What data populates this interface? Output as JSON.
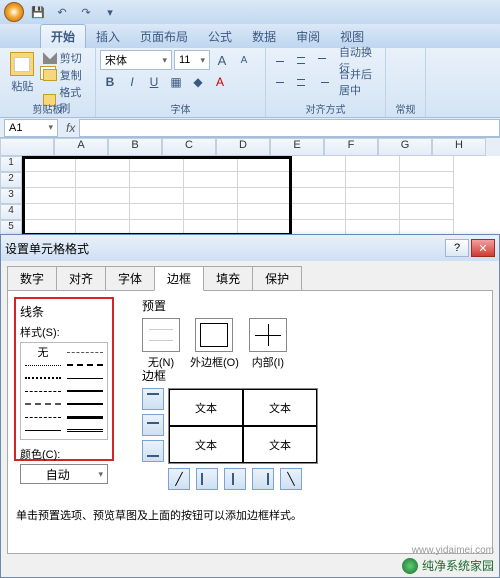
{
  "qat": {
    "save": "💾",
    "undo": "↶",
    "redo": "↷",
    "more": "▾"
  },
  "tabs": [
    "开始",
    "插入",
    "页面布局",
    "公式",
    "数据",
    "审阅",
    "视图"
  ],
  "ribbon": {
    "clipboard": {
      "paste": "粘贴",
      "cut": "剪切",
      "copy": "复制",
      "format_painter": "格式刷",
      "group": "剪贴板"
    },
    "font": {
      "name": "宋体",
      "size": "11",
      "grow": "A",
      "shrink": "A",
      "bold": "B",
      "italic": "I",
      "underline": "U",
      "group": "字体"
    },
    "align": {
      "wrap": "自动换行",
      "merge": "合并后居中",
      "group": "对齐方式"
    },
    "general_group": "常规"
  },
  "namebox": {
    "ref": "A1",
    "fx": "fx"
  },
  "columns": [
    "A",
    "B",
    "C",
    "D",
    "E",
    "F",
    "G",
    "H"
  ],
  "rows": [
    "1",
    "2",
    "3",
    "4",
    "5"
  ],
  "dialog": {
    "title": "设置单元格格式",
    "tabs": [
      "数字",
      "对齐",
      "字体",
      "边框",
      "填充",
      "保护"
    ],
    "active_tab": 3,
    "line_section": "线条",
    "style_label": "样式(S):",
    "style_none": "无",
    "color_label": "颜色(C):",
    "color_auto": "自动",
    "preset_section": "预置",
    "presets": {
      "none": "无(N)",
      "outline": "外边框(O)",
      "inside": "内部(I)"
    },
    "border_section": "边框",
    "sample_text": "文本",
    "hint": "单击预置选项、预览草图及上面的按钮可以添加边框样式。"
  },
  "watermark": {
    "url": "www.yidaimei.com",
    "brand": "纯净系统家园"
  }
}
